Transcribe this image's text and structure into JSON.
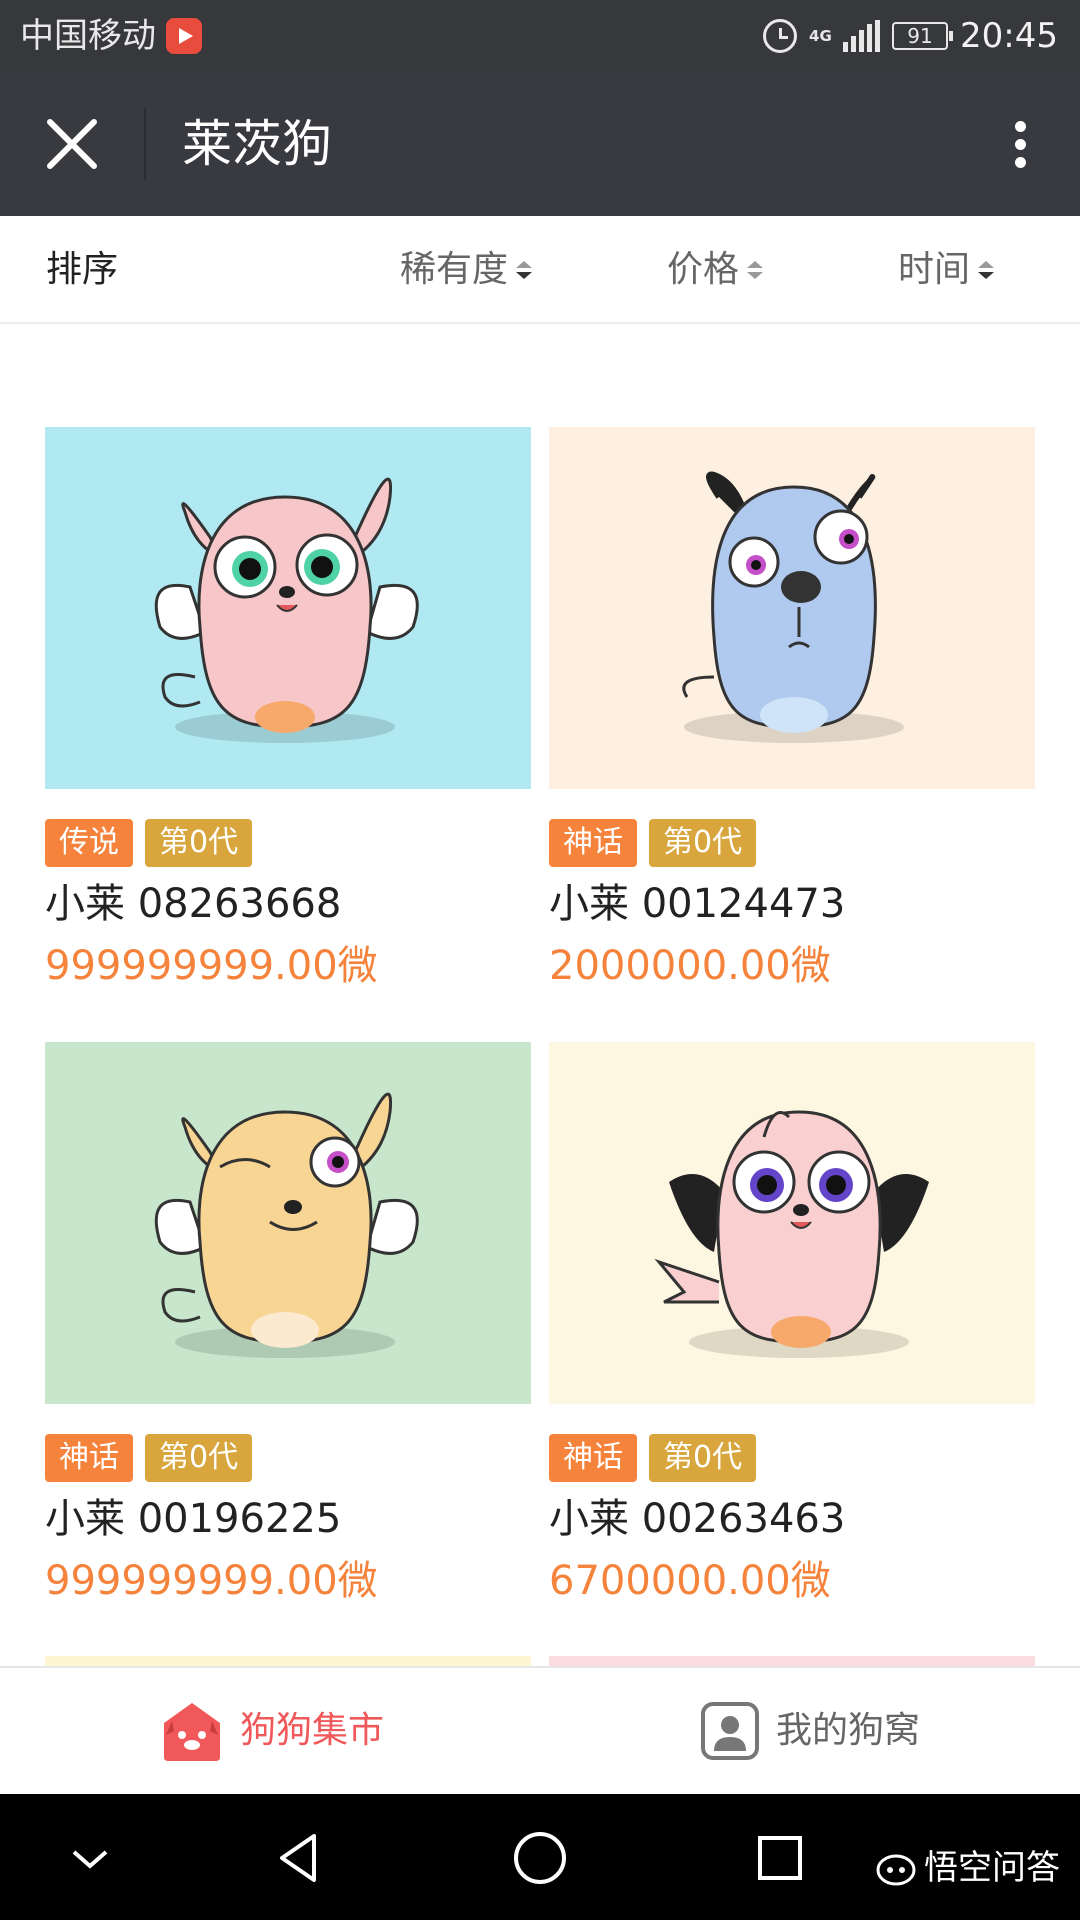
{
  "status_bar": {
    "carrier": "中国移动",
    "network": "4G",
    "battery": "91",
    "time": "20:45"
  },
  "app_bar": {
    "title": "莱茨狗"
  },
  "sort_bar": {
    "label": "排序",
    "options": [
      {
        "label": "稀有度"
      },
      {
        "label": "价格"
      },
      {
        "label": "时间"
      }
    ]
  },
  "dogs": [
    {
      "rarity": "传说",
      "generation": "第0代",
      "name": "小莱 08263668",
      "price": "999999999.00微",
      "bg_color": "#b1e9f2"
    },
    {
      "rarity": "神话",
      "generation": "第0代",
      "name": "小莱 00124473",
      "price": "2000000.00微",
      "bg_color": "#fdf0e0"
    },
    {
      "rarity": "神话",
      "generation": "第0代",
      "name": "小莱 00196225",
      "price": "999999999.00微",
      "bg_color": "#c8e6cb"
    },
    {
      "rarity": "神话",
      "generation": "第0代",
      "name": "小莱 00263463",
      "price": "6700000.00微",
      "bg_color": "#fdf6e1"
    }
  ],
  "tab_bar": {
    "market_label": "狗狗集市",
    "mine_label": "我的狗窝"
  },
  "watermark": "悟空问答",
  "colors": {
    "accent_orange": "#f5833b",
    "gold": "#d9a63e",
    "tab_active": "#f0585a",
    "app_bar": "#393a3f"
  }
}
